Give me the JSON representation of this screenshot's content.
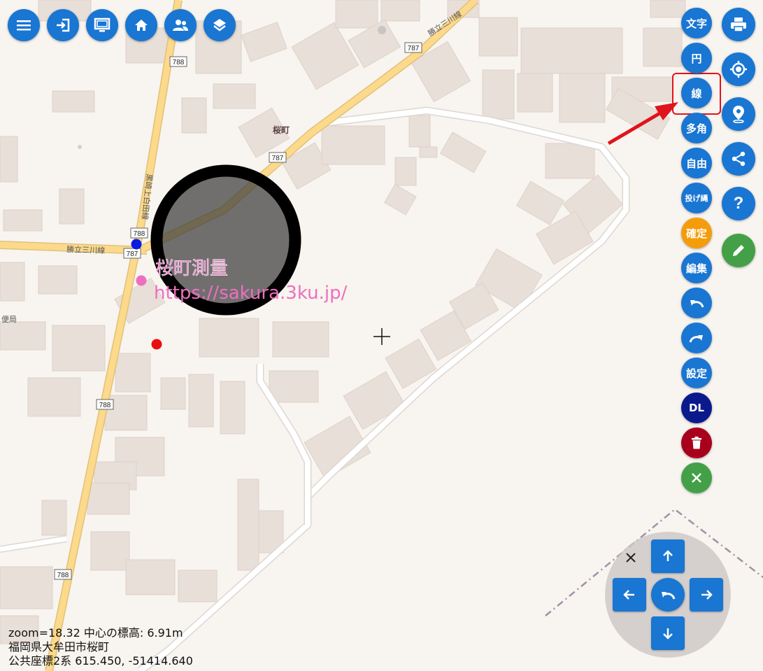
{
  "map": {
    "place_label": "桜町",
    "road_names": [
      "勝立三川線",
      "勝立三川線",
      "黒崎上白田線"
    ],
    "route_numbers": [
      "787",
      "787",
      "788",
      "788",
      "787",
      "788",
      "788"
    ],
    "partial_label": "便局"
  },
  "watermark": {
    "title": "桜町測量",
    "url": "https://sakura.3ku.jp/"
  },
  "draw_tools": {
    "text": "文字",
    "circle": "円",
    "line": "線",
    "polygon": "多角",
    "free": "自由",
    "lasso": "投げ縄",
    "confirm": "確定",
    "edit": "編集",
    "settings": "設定",
    "download": "DL"
  },
  "info": {
    "zoom_line": "zoom=18.32 中心の標高: 6.91m",
    "address_line": "福岡県大牟田市桜町",
    "coord_line": "公共座標2系 615.450, -51414.640"
  },
  "icons": {
    "menu": "menu-icon",
    "login": "login-icon",
    "screen": "monitor-icon",
    "home": "home-icon",
    "users": "users-icon",
    "layers": "layers-icon",
    "print": "print-icon",
    "locate": "crosshair-location-icon",
    "pin": "map-pin-icon",
    "share": "share-icon",
    "help": "help-icon",
    "pencil": "pencil-icon"
  },
  "colors": {
    "primary": "#1976d2",
    "confirm": "#f59c0b",
    "download": "#0a1a8c",
    "delete": "#a8001c",
    "close": "#43a047",
    "highlight": "#e0141c",
    "watermark": "#ee6fc0"
  }
}
